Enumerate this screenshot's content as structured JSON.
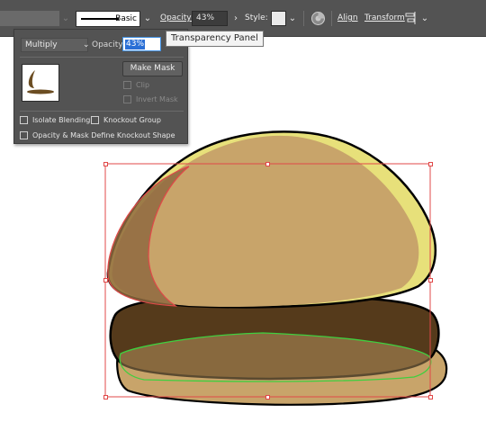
{
  "control_bar": {
    "stroke_profile": "Basic",
    "opacity_label": "Opacity:",
    "opacity_value": "43%",
    "style_label": "Style:",
    "align_label": "Align",
    "transform_label": "Transform"
  },
  "tooltip": {
    "text": "Transparency Panel"
  },
  "transparency_panel": {
    "blend_mode": "Multiply",
    "opacity_label": "Opacity:",
    "opacity_value": "43%",
    "make_mask_label": "Make Mask",
    "clip_label": "Clip",
    "invert_mask_label": "Invert Mask",
    "isolate_blending_label": "Isolate Blending",
    "knockout_group_label": "Knockout Group",
    "opacity_mask_knockout_label": "Opacity & Mask Define Knockout Shape"
  },
  "colors": {
    "panel_bg": "#535353",
    "bun_tan": "#c8a46a",
    "bun_yellow": "#e7e07a",
    "patty_brown": "#553a1b",
    "bun_overlay_dark": "#8f6a3f",
    "selection_red": "#e04848",
    "path_green": "#3fcf3f"
  }
}
